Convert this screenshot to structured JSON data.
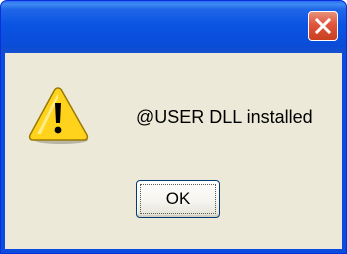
{
  "dialog": {
    "title": "",
    "message": "@USER DLL installed",
    "icon": "warning-icon",
    "close_icon": "close-icon"
  },
  "buttons": {
    "ok_label": "OK"
  },
  "colors": {
    "titlebar": "#0a55e3",
    "client_background": "#ece9d8",
    "close_button": "#e0553c",
    "warning_fill": "#ffd21c"
  }
}
